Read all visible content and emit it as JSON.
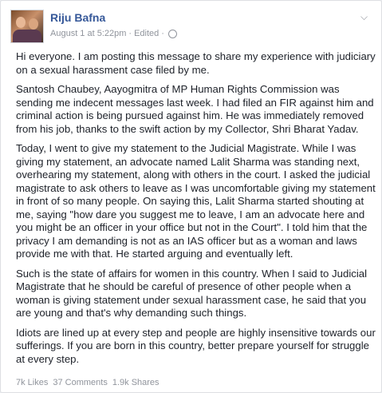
{
  "post": {
    "author": "Riju Bafna",
    "timestamp": "August 1 at 5:22pm",
    "separator": "·",
    "edited_label": "Edited",
    "privacy_icon": "globe-icon",
    "paragraphs": [
      "Hi everyone. I am posting this message to share my experience with judiciary on a sexual harassment case filed by me.",
      "Santosh Chaubey, Aayogmitra of MP Human Rights Commission was sending me indecent messages last week. I had filed an FIR against him and criminal action is being pursued against him. He was immediately removed from his job, thanks to the swift action by my Collector, Shri Bharat Yadav.",
      "Today, I went to give my statement to the Judicial Magistrate. While I was giving my statement, an advocate named Lalit Sharma was standing next, overhearing my statement, along with others in the court. I asked the judicial magistrate to ask others to leave as I was uncomfortable giving my statement in front of so many people. On saying this, Lalit Sharma started shouting at me, saying \"how dare you suggest me to leave, I am an advocate here and you might be an officer in your office but not in the Court\". I told him that the privacy I am demanding is not as an IAS officer but as a woman and laws provide me with that. He started arguing and eventually left.",
      "Such is the state of affairs for women in this country. When I said to Judicial Magistrate that he should be careful of presence of other people when a woman is giving statement under sexual harassment case, he said that you are young and that's why demanding such things.",
      "Idiots are lined up at every step and people are highly insensitive towards our sufferings. If you are born in this country, better prepare yourself for struggle at every step."
    ],
    "stats": {
      "likes": "7k Likes",
      "comments": "37 Comments",
      "shares": "1.9k Shares"
    }
  },
  "colors": {
    "author_link": "#365899",
    "meta_text": "#90949c",
    "body_text": "#1d2129",
    "card_bg": "#ffffff",
    "page_bg": "#e9ebee"
  }
}
